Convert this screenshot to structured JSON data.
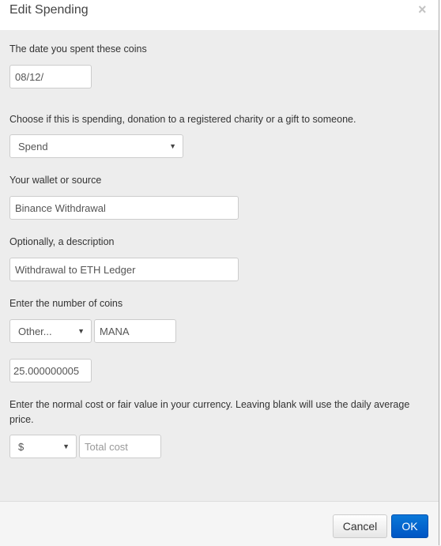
{
  "dialog": {
    "title": "Edit Spending",
    "close_icon": "×"
  },
  "form": {
    "date": {
      "label": "The date you spent these coins",
      "value": "08/12/"
    },
    "type": {
      "label": "Choose if this is spending, donation to a registered charity or a gift to someone.",
      "selected": "Spend"
    },
    "wallet": {
      "label": "Your wallet or source",
      "value": "Binance Withdrawal"
    },
    "description": {
      "label": "Optionally, a description",
      "value": "Withdrawal to ETH Ledger"
    },
    "coins": {
      "label": "Enter the number of coins",
      "coin_select": "Other...",
      "coin_symbol": "MANA",
      "amount": "25.000000005"
    },
    "cost": {
      "label_line1": "Enter the normal cost or fair value in your currency. Leaving blank will use the daily average",
      "label_line2": "price.",
      "currency_select": "$",
      "total_placeholder": "Total cost"
    },
    "caret": "▼"
  },
  "footer": {
    "cancel_label": "Cancel",
    "ok_label": "OK"
  },
  "colors": {
    "primary": "#0a6ad2",
    "body_bg": "#ededed"
  }
}
